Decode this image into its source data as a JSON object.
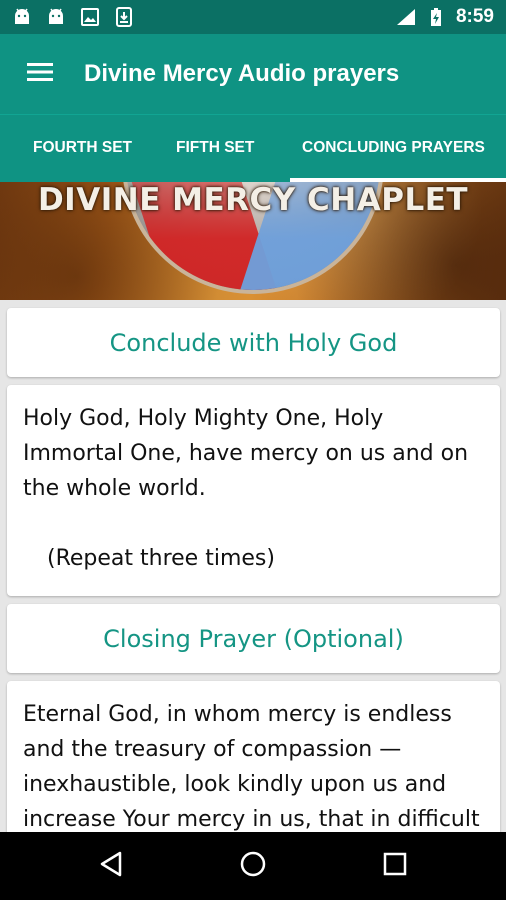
{
  "status_bar": {
    "time": "8:59",
    "icons": [
      "android-icon",
      "android-icon",
      "image-icon",
      "download-icon",
      "signal-icon",
      "battery-charging-icon"
    ]
  },
  "app_bar": {
    "title": "Divine Mercy Audio prayers",
    "menu_icon": "hamburger-menu-icon"
  },
  "tabs": [
    {
      "label": "FOURTH SET"
    },
    {
      "label": "FIFTH SET"
    },
    {
      "label": "CONCLUDING PRAYERS",
      "selected": true
    }
  ],
  "banner": {
    "title": "DIVINE MERCY CHAPLET"
  },
  "cards": [
    {
      "heading": "Conclude with Holy God"
    },
    {
      "text": "Holy God, Holy Mighty One, Holy Immortal One, have mercy on us and on the whole world.",
      "note": "(Repeat three times)"
    },
    {
      "heading": "Closing Prayer (Optional)"
    },
    {
      "text": "Eternal God, in whom mercy is endless and the treasury of compassion — inexhaustible, look kindly upon us and increase Your mercy in us, that in difficult"
    }
  ],
  "nav_bar": {
    "icons": [
      "back-icon",
      "home-icon",
      "recents-icon"
    ]
  },
  "colors": {
    "status_bar": "#0b7064",
    "app_bar": "#0f9383",
    "accent_text": "#159584",
    "background": "#e6e6e6"
  }
}
